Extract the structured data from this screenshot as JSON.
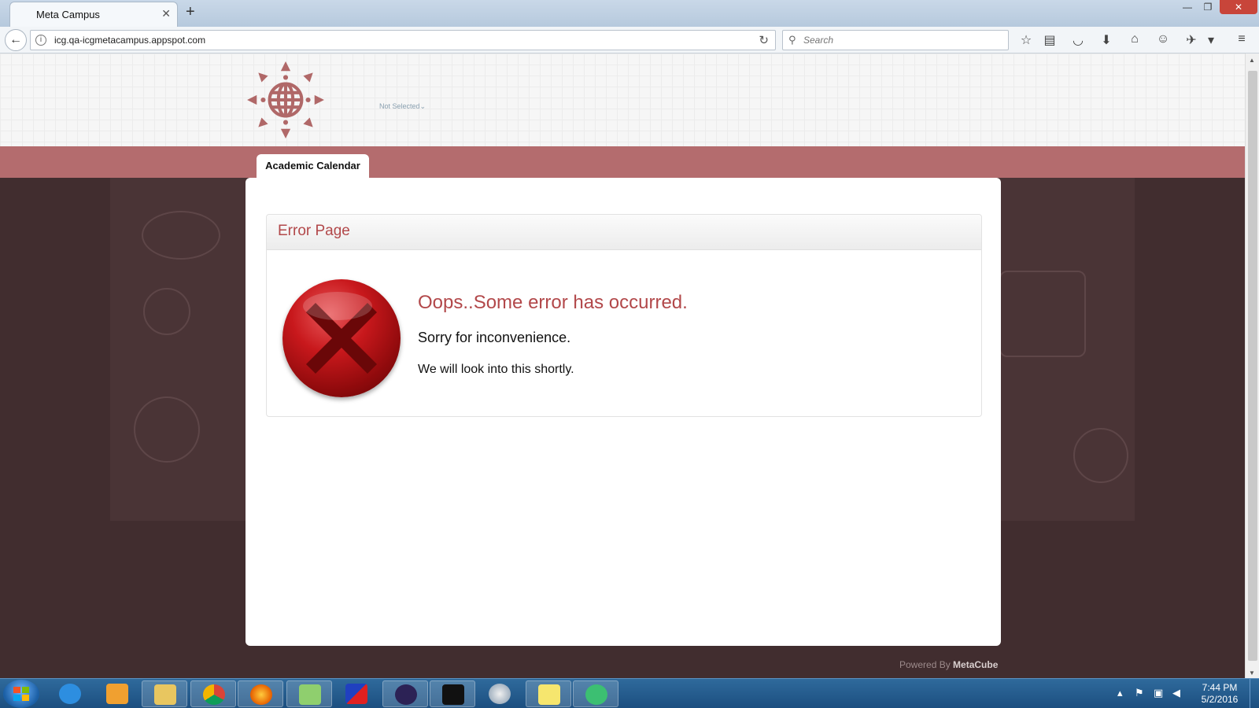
{
  "browser": {
    "tab_title": "Meta Campus",
    "url": "icg.qa-icgmetacampus.appspot.com",
    "search_placeholder": "Search"
  },
  "site": {
    "dropdown_text": "Not Selected",
    "menu_tab": "Academic Calendar",
    "colors": {
      "brand": "#b46c6e",
      "background": "#412d2f",
      "accent_text": "#b2484a"
    }
  },
  "error": {
    "title": "Error Page",
    "message": "Oops..Some error has occurred.",
    "sorry": "Sorry for inconvenience.",
    "followup": "We will look into this shortly."
  },
  "footer": {
    "powered_prefix": "Powered By",
    "powered_brand": "MetaCube"
  },
  "taskbar": {
    "time": "7:44 PM",
    "date": "5/2/2016"
  }
}
